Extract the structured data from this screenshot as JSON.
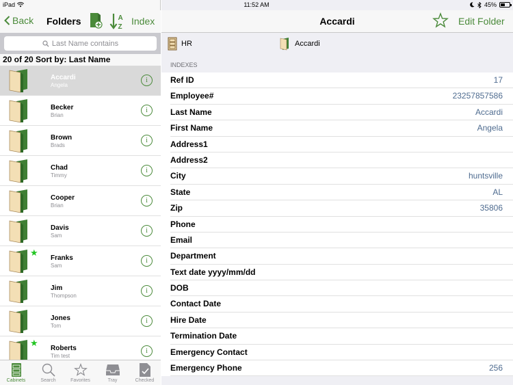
{
  "status": {
    "device": "iPad",
    "time": "11:52 AM",
    "battery": "45%"
  },
  "left_nav": {
    "back_label": "Back",
    "title": "Folders",
    "index_label": "Index"
  },
  "search": {
    "placeholder": "Last Name contains"
  },
  "count_text": "20 of 20 Sort by: Last Name",
  "folders": [
    {
      "name": "Accardi",
      "sub": "Angela",
      "starred": false,
      "selected": true
    },
    {
      "name": "Becker",
      "sub": "Brian",
      "starred": false,
      "selected": false
    },
    {
      "name": "Brown",
      "sub": "Brads",
      "starred": false,
      "selected": false
    },
    {
      "name": "Chad",
      "sub": "Timmy",
      "starred": false,
      "selected": false
    },
    {
      "name": "Cooper",
      "sub": "Brian",
      "starred": false,
      "selected": false
    },
    {
      "name": "Davis",
      "sub": "Sam",
      "starred": false,
      "selected": false
    },
    {
      "name": "Franks",
      "sub": "Sam",
      "starred": true,
      "selected": false
    },
    {
      "name": "Jim",
      "sub": "Thompson",
      "starred": false,
      "selected": false
    },
    {
      "name": "Jones",
      "sub": "Tom",
      "starred": false,
      "selected": false
    },
    {
      "name": "Roberts",
      "sub": "Tim test",
      "starred": true,
      "selected": false
    }
  ],
  "tabs": [
    {
      "label": "Cabinets",
      "icon": "cabinet-icon",
      "active": true
    },
    {
      "label": "Search",
      "icon": "search-icon",
      "active": false
    },
    {
      "label": "Favorites",
      "icon": "star-icon",
      "active": false
    },
    {
      "label": "Tray",
      "icon": "tray-icon",
      "active": false
    },
    {
      "label": "Checked",
      "icon": "checked-doc-icon",
      "active": false
    }
  ],
  "right_nav": {
    "title": "Accardi",
    "edit_label": "Edit Folder"
  },
  "breadcrumbs": [
    {
      "label": "HR",
      "icon": "cabinet-icon"
    },
    {
      "label": "Accardi",
      "icon": "folder-icon"
    }
  ],
  "section_header": "INDEXES",
  "indexes": [
    {
      "label": "Ref ID",
      "value": "17"
    },
    {
      "label": "Employee#",
      "value": "23257857586"
    },
    {
      "label": "Last Name",
      "value": "Accardi"
    },
    {
      "label": "First Name",
      "value": "Angela"
    },
    {
      "label": "Address1",
      "value": ""
    },
    {
      "label": "Address2",
      "value": ""
    },
    {
      "label": "City",
      "value": "huntsville"
    },
    {
      "label": "State",
      "value": "AL"
    },
    {
      "label": "Zip",
      "value": "35806"
    },
    {
      "label": "Phone",
      "value": ""
    },
    {
      "label": "Email",
      "value": ""
    },
    {
      "label": "Department",
      "value": ""
    },
    {
      "label": "Text date yyyy/mm/dd",
      "value": ""
    },
    {
      "label": "DOB",
      "value": ""
    },
    {
      "label": "Contact Date",
      "value": ""
    },
    {
      "label": "Hire Date",
      "value": ""
    },
    {
      "label": "Termination Date",
      "value": ""
    },
    {
      "label": "Emergency Contact",
      "value": ""
    },
    {
      "label": "Emergency Phone",
      "value": "256"
    }
  ],
  "colors": {
    "accent": "#4a8a3a",
    "value_text": "#4e6b8f",
    "star": "#22c522"
  }
}
